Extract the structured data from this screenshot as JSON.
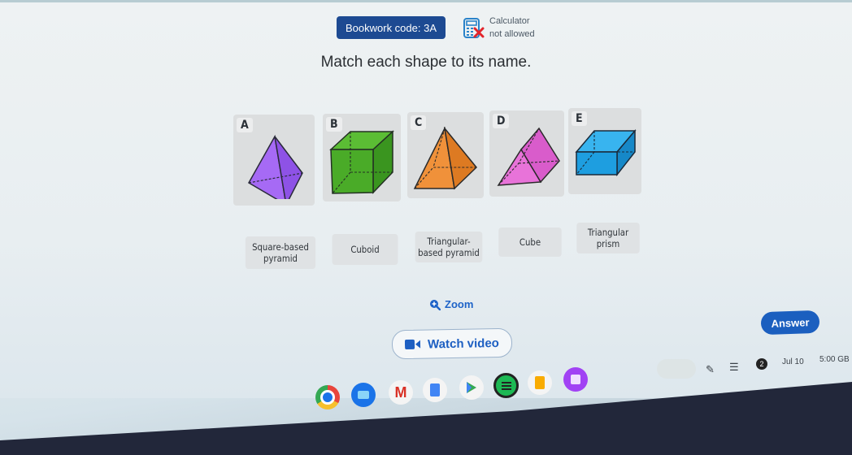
{
  "header": {
    "bookwork_label": "Bookwork code: 3A",
    "calculator_line1": "Calculator",
    "calculator_line2": "not allowed",
    "calculator_icon": "calculator-crossed-icon"
  },
  "question": "Match each shape to its name.",
  "shapes": [
    {
      "letter": "A",
      "shape": "triangular-based-pyramid",
      "color": "#9b5ef2"
    },
    {
      "letter": "B",
      "shape": "cube",
      "color": "#42a526"
    },
    {
      "letter": "C",
      "shape": "square-based-pyramid",
      "color": "#ee8a2c"
    },
    {
      "letter": "D",
      "shape": "triangular-prism",
      "color": "#e167d2"
    },
    {
      "letter": "E",
      "shape": "cuboid",
      "color": "#1e9ee0"
    }
  ],
  "names": [
    {
      "label": "Square-based pyramid"
    },
    {
      "label": "Cuboid"
    },
    {
      "label": "Triangular-based pyramid"
    },
    {
      "label": "Cube"
    },
    {
      "label": "Triangular prism"
    }
  ],
  "actions": {
    "zoom_label": "Zoom",
    "watch_video_label": "Watch video",
    "answer_label": "Answer"
  },
  "shelf": {
    "apps": [
      {
        "name": "chrome"
      },
      {
        "name": "files"
      },
      {
        "name": "gmail"
      },
      {
        "name": "docs"
      },
      {
        "name": "play-store"
      },
      {
        "name": "spotify"
      },
      {
        "name": "keep"
      },
      {
        "name": "app"
      }
    ],
    "date": "Jul 10",
    "time": "5:00",
    "region": "GB",
    "notification_count": "2"
  },
  "colors": {
    "brand_blue": "#1d4a92",
    "accent_blue": "#1b5fbf"
  }
}
